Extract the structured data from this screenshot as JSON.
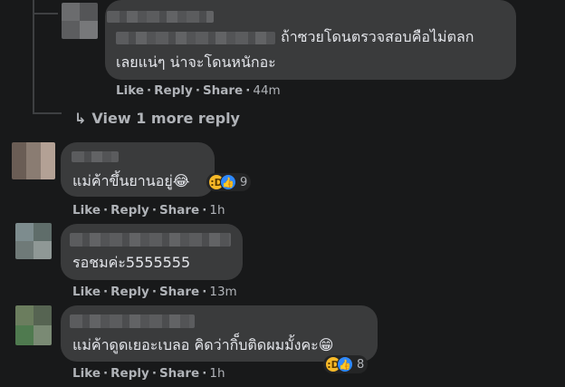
{
  "top_reply": {
    "name_partial": "Happy Aaaaa",
    "text_line1": "ถ้าซวยโดนตรวจสอบคือไม่ตลก",
    "text_line2": "เลยแน่ๆ น่าจะโดนหนักอะ",
    "like": "Like",
    "reply": "Reply",
    "share": "Share",
    "time": "44m"
  },
  "view_more": {
    "arrow": "↳",
    "label": "View 1 more reply"
  },
  "comments": [
    {
      "name_partial": "แ ตโ",
      "text": "แม่ค้าขึ้นยานอยู่😂",
      "reaction_count": "9",
      "like": "Like",
      "reply": "Reply",
      "share": "Share",
      "time": "1h"
    },
    {
      "text": "รอชมค่ะ5555555",
      "like": "Like",
      "reply": "Reply",
      "share": "Share",
      "time": "13m"
    },
    {
      "text": "แม่ค้าดูดเยอะเบลอ คิดว่ากิ็บติดผมมั้งคะ😁",
      "reaction_count": "8",
      "like": "Like",
      "reply": "Reply",
      "share": "Share",
      "time": "1h"
    }
  ],
  "colors": {
    "background": "#18191a",
    "bubble": "#3a3b3c",
    "text": "#e4e6eb",
    "secondary": "#b0b3b8",
    "like_blue": "#2e89ff",
    "haha_yellow": "#f7b928"
  },
  "icons": [
    "haha-reaction-icon",
    "like-reaction-icon",
    "reply-arrow-icon"
  ]
}
